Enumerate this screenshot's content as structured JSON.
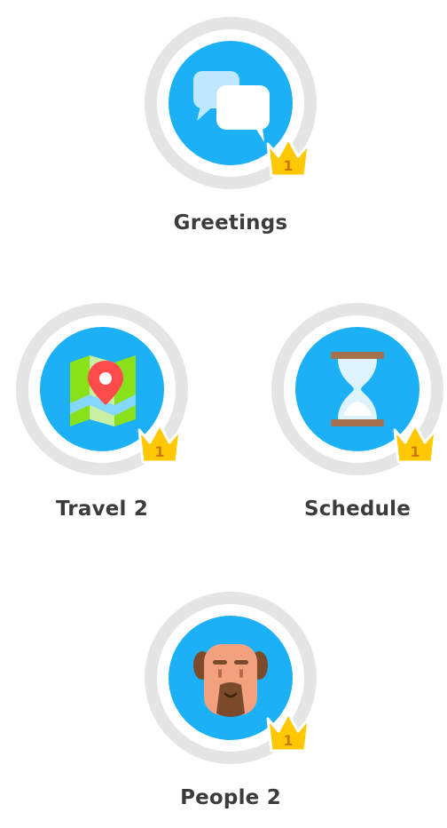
{
  "skills": [
    {
      "id": "greetings",
      "label": "Greetings",
      "crown_level": "1",
      "icon": "chat-bubbles-icon"
    },
    {
      "id": "travel",
      "label": "Travel 2",
      "crown_level": "1",
      "icon": "map-pin-icon"
    },
    {
      "id": "schedule",
      "label": "Schedule",
      "crown_level": "1",
      "icon": "hourglass-icon"
    },
    {
      "id": "people",
      "label": "People 2",
      "crown_level": "1",
      "icon": "bearded-man-icon"
    }
  ],
  "colors": {
    "ring": "#e5e5e5",
    "circle": "#1cb0f6",
    "crown": "#ffc800",
    "crown_text": "#cd7900",
    "label": "#3c3c3c"
  }
}
